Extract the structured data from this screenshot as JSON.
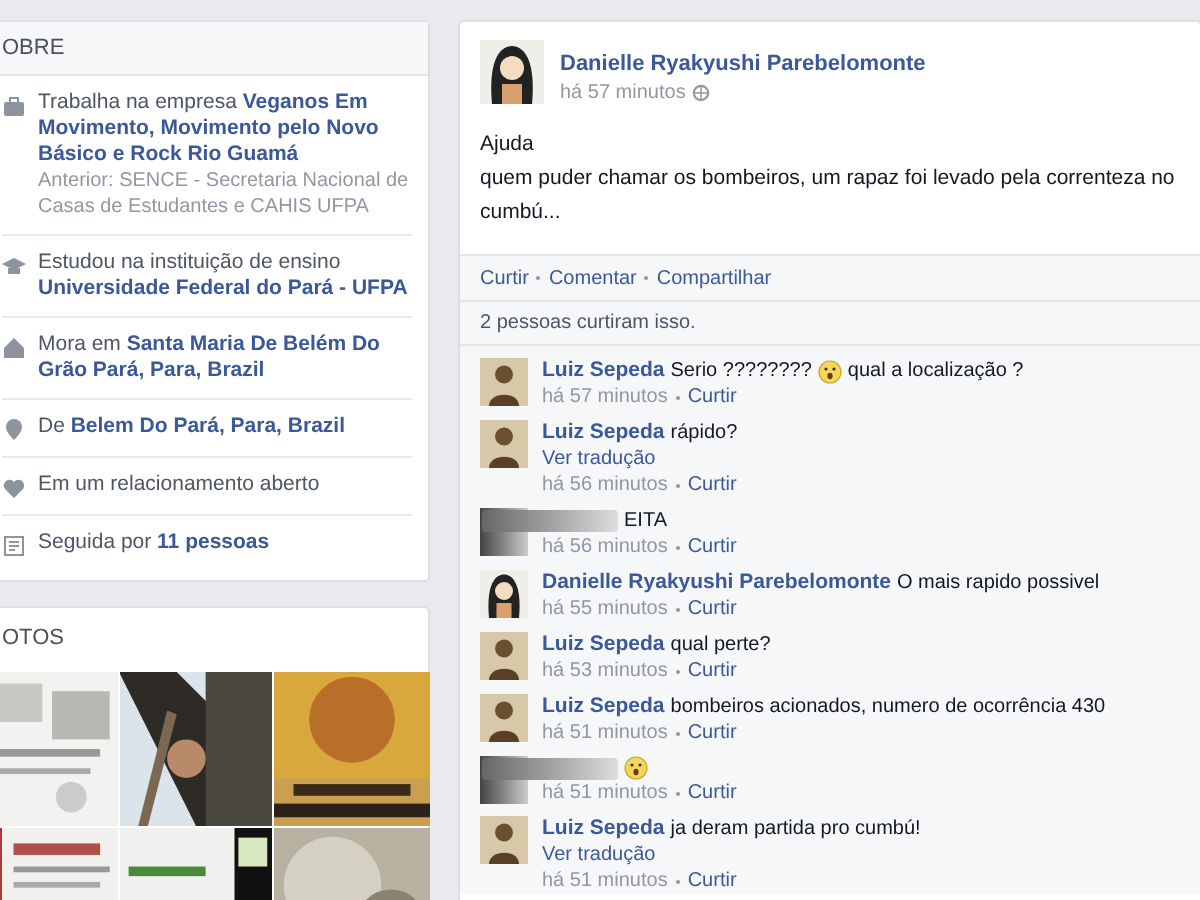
{
  "about": {
    "title": "OBRE",
    "items": [
      {
        "kind": "work",
        "text": "Trabalha na empresa **Veganos Em Movimento, Movimento pelo Novo Básico e Rock Rio Guamá**",
        "sub": "Anterior: SENCE - Secretaria Nacional de Casas de Estudantes e CAHIS UFPA"
      },
      {
        "kind": "study",
        "text": "Estudou na instituição de ensino **Universidade Federal do Pará - UFPA**"
      },
      {
        "kind": "home",
        "text": "Mora em **Santa Maria De Belém Do Grão Pará, Para, Brazil**"
      },
      {
        "kind": "place",
        "text": "De **Belem Do Pará, Para, Brazil**"
      },
      {
        "kind": "heart",
        "text": "Em um relacionamento aberto"
      },
      {
        "kind": "followers",
        "text": "Seguida por **11 pessoas**"
      }
    ]
  },
  "photos": {
    "title": "OTOS"
  },
  "post": {
    "author": "Danielle Ryakyushi Parebelomonte",
    "time": "há 57 minutos",
    "body": [
      "Ajuda",
      "quem puder chamar os bombeiros, um rapaz foi levado pela correnteza no cumbú..."
    ],
    "actions": [
      "Curtir",
      "Comentar",
      "Compartilhar"
    ],
    "likes": "2 pessoas curtiram isso.",
    "comments": [
      {
        "kind": "luiz",
        "author": "Luiz Sepeda",
        "parts": [
          {
            "kind": "text",
            "text": "Serio ????????"
          },
          {
            "kind": "emoji"
          },
          {
            "kind": "text",
            "text": "qual a localização ?"
          }
        ],
        "time": "há 57 minutos",
        "like": "Curtir"
      },
      {
        "kind": "luiz",
        "author": "Luiz Sepeda",
        "parts": [
          {
            "kind": "text",
            "text": "rápido?"
          }
        ],
        "translate": "Ver tradução",
        "time": "há 56 minutos",
        "like": "Curtir"
      },
      {
        "kind": "blurred",
        "parts": [
          {
            "kind": "text",
            "text": "EITA"
          }
        ],
        "time": "há 56 minutos",
        "like": "Curtir"
      },
      {
        "kind": "danielle",
        "author": "Danielle Ryakyushi Parebelomonte",
        "parts": [
          {
            "kind": "text",
            "text": "O mais rapido possivel"
          }
        ],
        "time": "há 55 minutos",
        "like": "Curtir"
      },
      {
        "kind": "luiz",
        "author": "Luiz Sepeda",
        "parts": [
          {
            "kind": "text",
            "text": "qual perte?"
          }
        ],
        "time": "há 53 minutos",
        "like": "Curtir"
      },
      {
        "kind": "luiz",
        "author": "Luiz Sepeda",
        "parts": [
          {
            "kind": "text",
            "text": "bombeiros acionados, numero de ocorrência 430"
          }
        ],
        "time": "há 51 minutos",
        "like": "Curtir"
      },
      {
        "kind": "blurred",
        "parts": [
          {
            "kind": "emoji"
          }
        ],
        "time": "há 51 minutos",
        "like": "Curtir"
      },
      {
        "kind": "luiz",
        "author": "Luiz Sepeda",
        "parts": [
          {
            "kind": "text",
            "text": "ja deram partida pro cumbú!"
          }
        ],
        "translate": "Ver tradução",
        "time": "há 51 minutos",
        "like": "Curtir"
      }
    ]
  }
}
